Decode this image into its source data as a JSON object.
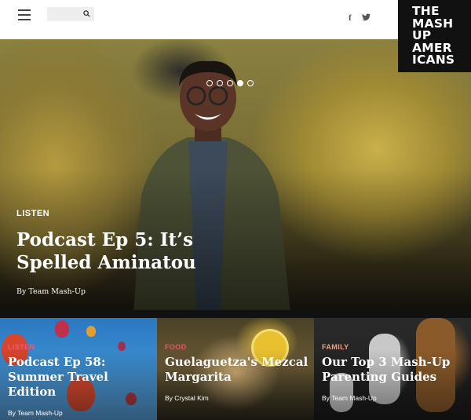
{
  "header": {
    "search_placeholder": "",
    "social": {
      "facebook": "f",
      "twitter": "t"
    }
  },
  "logo": {
    "lines": [
      "THE",
      "MASH",
      "UP",
      "AMER",
      "ICANS"
    ]
  },
  "hero": {
    "category": "LISTEN",
    "title": "Podcast Ep 5: It’s Spelled Aminatou",
    "author": "By Team Mash-Up",
    "slide_count": 5,
    "active_slide": 4
  },
  "cards": [
    {
      "category": "LISTEN",
      "category_color": "#e85a7a",
      "title": "Podcast Ep 58: Summer Travel Edition",
      "author": "By Team Mash-Up"
    },
    {
      "category": "FOOD",
      "category_color": "#e8556a",
      "title": "Guelaguetza's Mezcal Margarita",
      "author": "By Crystal Kim"
    },
    {
      "category": "FAMILY",
      "category_color": "#f0a080",
      "title": "Our Top 3 Mash-Up Parenting Guides",
      "author": "By Team Mash-Up"
    }
  ]
}
